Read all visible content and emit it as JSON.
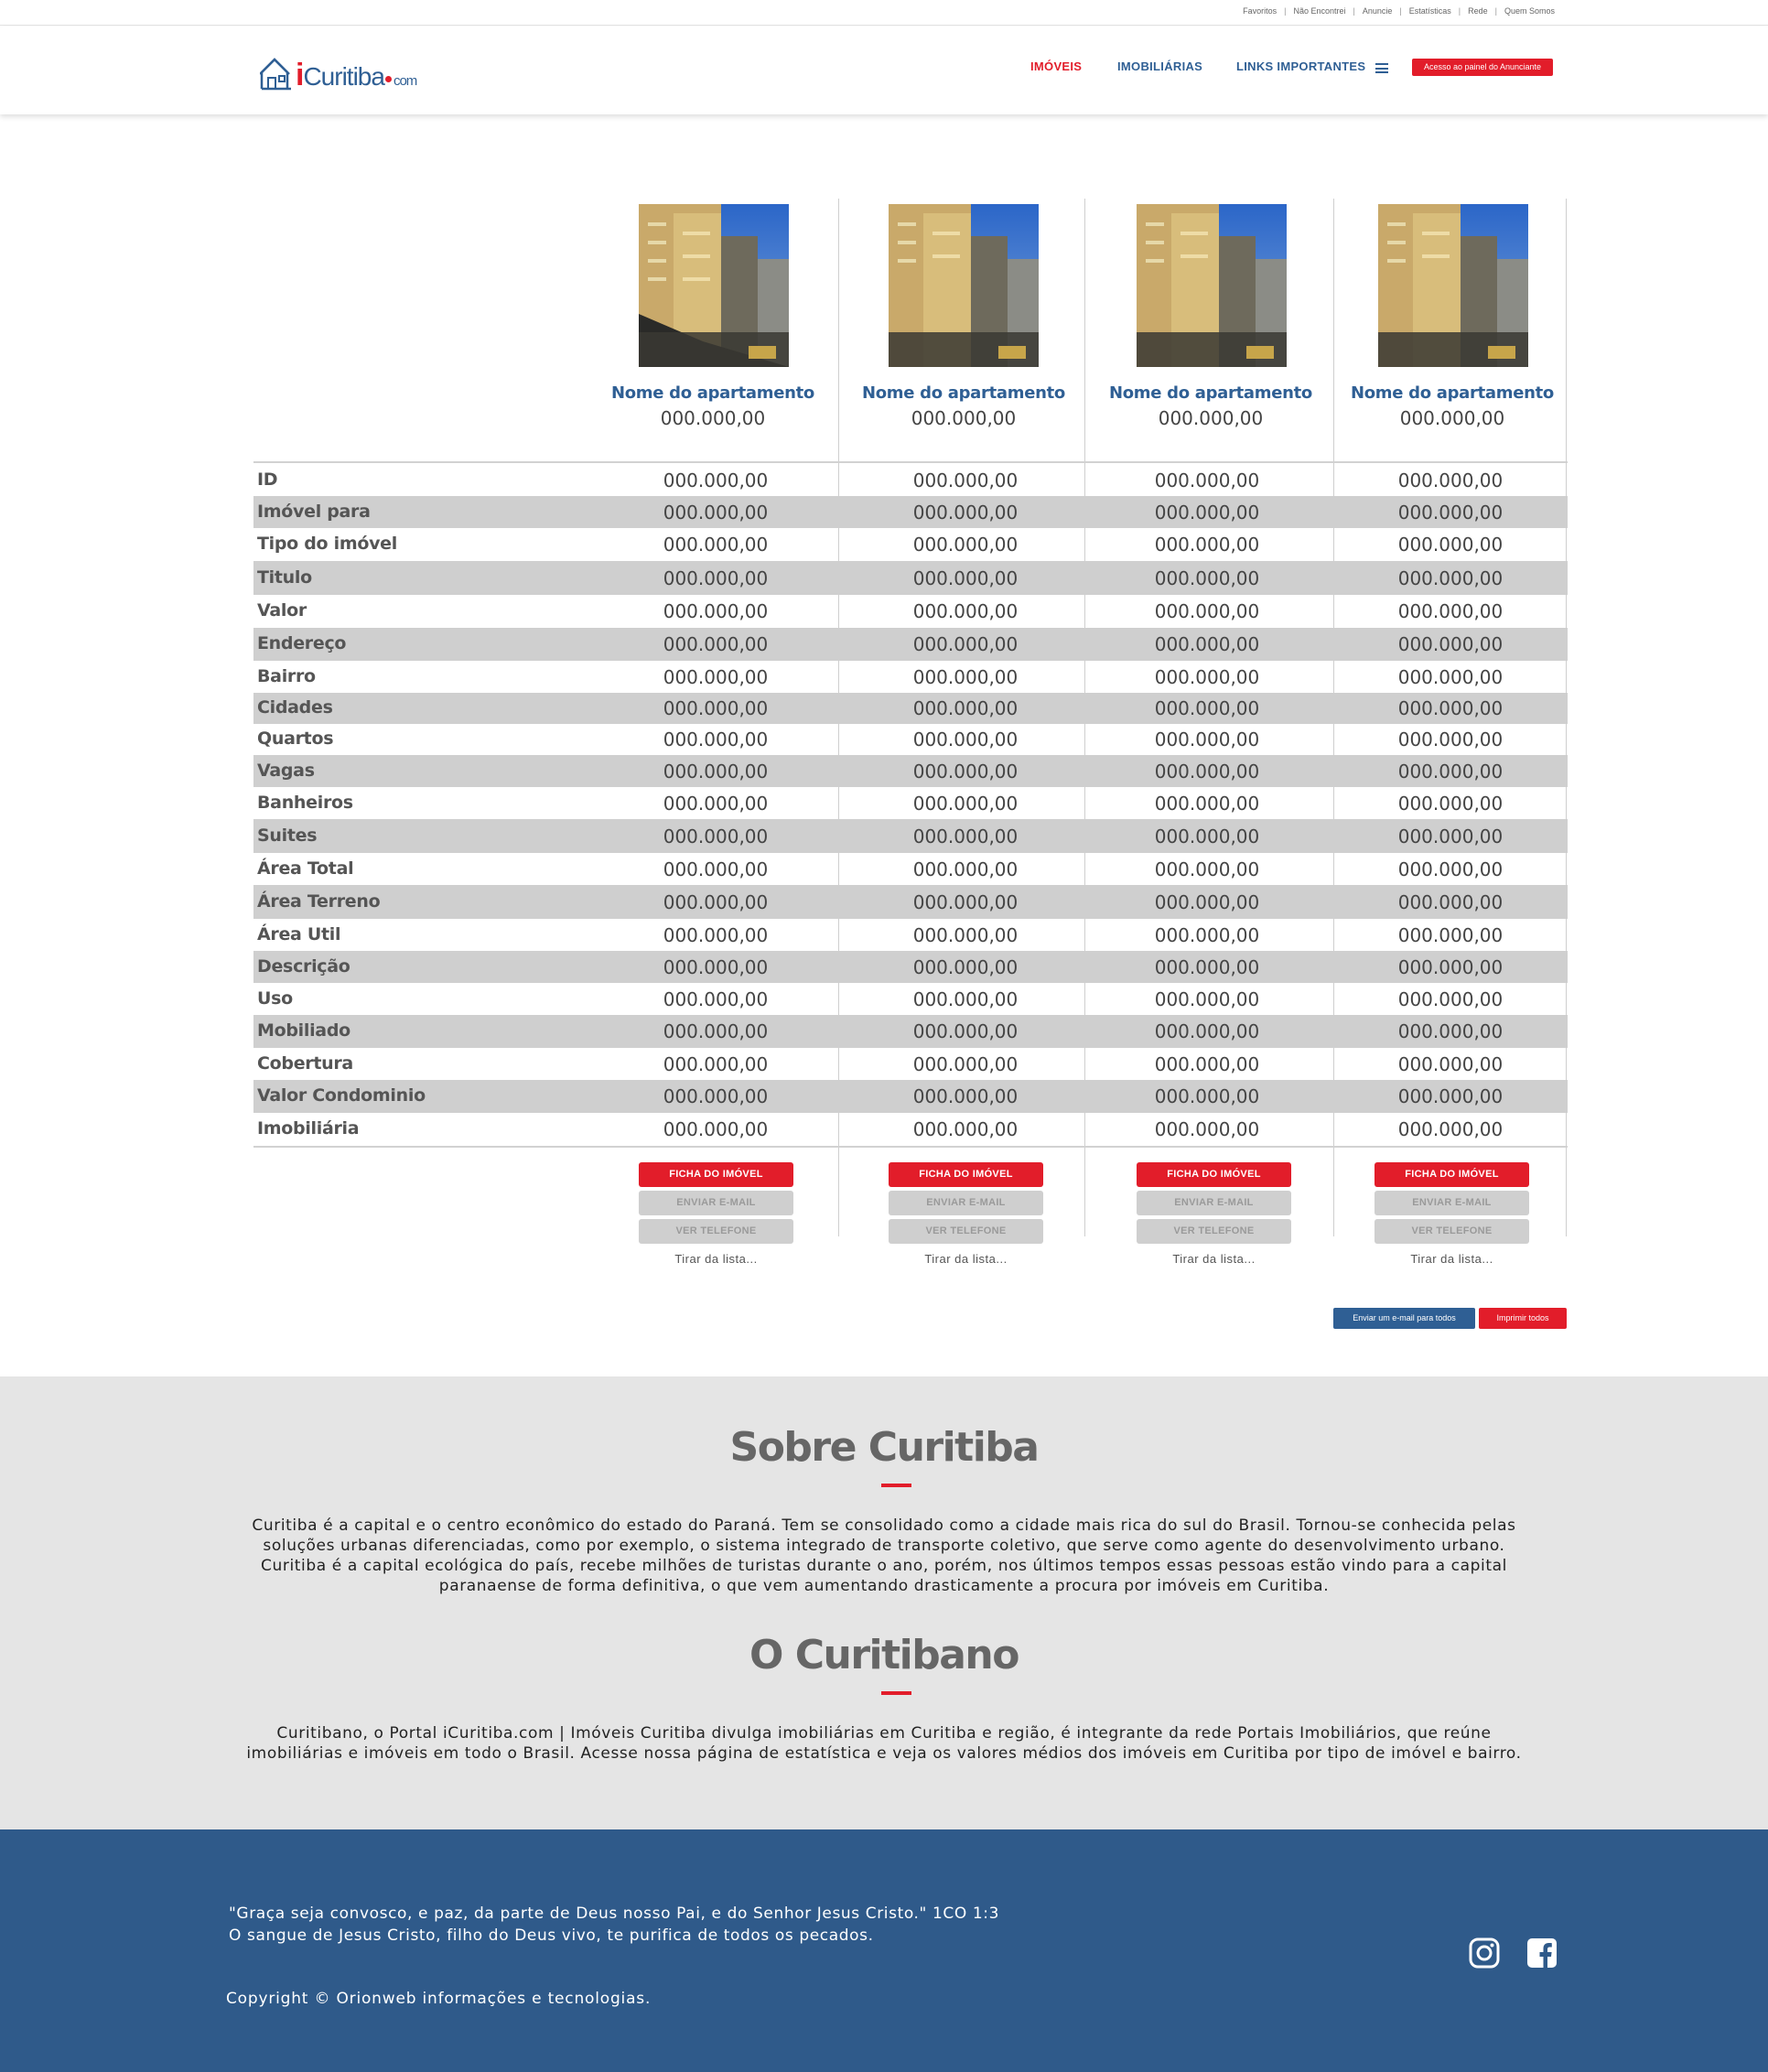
{
  "topbar": {
    "links": [
      "Favoritos",
      "Não Encontrei",
      "Anuncie",
      "Estatísticas",
      "Rede",
      "Quem Somos"
    ],
    "separator": "|"
  },
  "header": {
    "logo": {
      "i": "i",
      "name": "Curitiba",
      "tld": "com"
    },
    "nav": {
      "imoveis": "IMÓVEIS",
      "imobiliarias": "IMOBILIÁRIAS",
      "links": "LINKS IMPORTANTES"
    },
    "menu_icon": "hamburger-icon",
    "anunciante_button": "Acesso ao painel do Anunciante"
  },
  "compare": {
    "properties": [
      {
        "name": "Nome do apartamento",
        "price": "000.000,00",
        "values": [
          "000.000,00",
          "000.000,00",
          "000.000,00",
          "000.000,00",
          "000.000,00",
          "000.000,00",
          "000.000,00",
          "000.000,00",
          "000.000,00",
          "000.000,00",
          "000.000,00",
          "000.000,00",
          "000.000,00",
          "000.000,00",
          "000.000,00",
          "000.000,00",
          "000.000,00",
          "000.000,00",
          "000.000,00",
          "000.000,00",
          "000.000,00"
        ]
      },
      {
        "name": "Nome do apartamento",
        "price": "000.000,00",
        "values": [
          "000.000,00",
          "000.000,00",
          "000.000,00",
          "000.000,00",
          "000.000,00",
          "000.000,00",
          "000.000,00",
          "000.000,00",
          "000.000,00",
          "000.000,00",
          "000.000,00",
          "000.000,00",
          "000.000,00",
          "000.000,00",
          "000.000,00",
          "000.000,00",
          "000.000,00",
          "000.000,00",
          "000.000,00",
          "000.000,00",
          "000.000,00"
        ]
      },
      {
        "name": "Nome do apartamento",
        "price": "000.000,00",
        "values": [
          "000.000,00",
          "000.000,00",
          "000.000,00",
          "000.000,00",
          "000.000,00",
          "000.000,00",
          "000.000,00",
          "000.000,00",
          "000.000,00",
          "000.000,00",
          "000.000,00",
          "000.000,00",
          "000.000,00",
          "000.000,00",
          "000.000,00",
          "000.000,00",
          "000.000,00",
          "000.000,00",
          "000.000,00",
          "000.000,00",
          "000.000,00"
        ]
      },
      {
        "name": "Nome do apartamento",
        "price": "000.000,00",
        "values": [
          "000.000,00",
          "000.000,00",
          "000.000,00",
          "000.000,00",
          "000.000,00",
          "000.000,00",
          "000.000,00",
          "000.000,00",
          "000.000,00",
          "000.000,00",
          "000.000,00",
          "000.000,00",
          "000.000,00",
          "000.000,00",
          "000.000,00",
          "000.000,00",
          "000.000,00",
          "000.000,00",
          "000.000,00",
          "000.000,00",
          "000.000,00"
        ]
      }
    ],
    "row_labels": [
      "ID",
      "Imóvel para",
      "Tipo do imóvel",
      "Titulo",
      "Valor",
      "Endereço",
      "Bairro",
      "Cidades",
      "Quartos",
      "Vagas",
      "Banheiros",
      "Suites",
      "Área Total",
      "Área Terreno",
      "Área Util",
      "Descrição",
      "Uso",
      "Mobiliado",
      "Cobertura",
      "Valor Condominio",
      "Imobiliária"
    ],
    "buttons": {
      "ficha": "FICHA DO IMÓVEL",
      "email": "ENVIAR E-MAIL",
      "telefone": "VER TELEFONE",
      "remove": "Tirar da lista..."
    },
    "bulk": {
      "email_all": "Enviar  um e-mail para todos",
      "print_all": "Imprimir todos"
    }
  },
  "about": {
    "title1": "Sobre Curitiba",
    "text1_lines": [
      "Curitiba é a capital e o centro econômico do estado do Paraná. Tem se consolidado como a cidade mais rica do sul do Brasil. Tornou-se conhecida pelas",
      "soluções urbanas diferenciadas, como por exemplo, o sistema integrado de transporte coletivo, que serve como agente do desenvolvimento urbano.",
      "Curitiba é a capital ecológica do país, recebe milhões de turistas durante o ano, porém, nos últimos tempos essas pessoas estão vindo para a capital",
      "paranaense de forma definitiva, o que vem aumentando drasticamente a procura por imóveis em Curitiba."
    ],
    "title2": "O Curitibano",
    "text2_lines": [
      "Curitibano, o Portal iCuritiba.com | Imóveis Curitiba divulga imobiliárias em Curitiba e região, é integrante da rede Portais Imobiliários, que reúne",
      "imobiliárias e imóveis em todo o Brasil. Acesse nossa página de estatística e veja os valores médios dos imóveis em Curitiba por tipo de imóvel e bairro."
    ]
  },
  "footer": {
    "quote_line1": "\"Graça seja convosco, e paz, da parte de Deus nosso Pai, e do Senhor Jesus Cristo.\" 1CO 1:3",
    "quote_line2": "O sangue de Jesus Cristo, filho do Deus vivo, te purifica de todos os pecados.",
    "copyright": "Copyright © Orionweb informações e tecnologias.",
    "social": [
      "instagram-icon",
      "facebook-icon"
    ]
  },
  "colors": {
    "brand_red": "#e21d2a",
    "brand_blue": "#2f5f94",
    "footer_blue": "#2f5a8a",
    "row_shade": "#cfcfcf",
    "about_bg": "#e5e5e5"
  }
}
